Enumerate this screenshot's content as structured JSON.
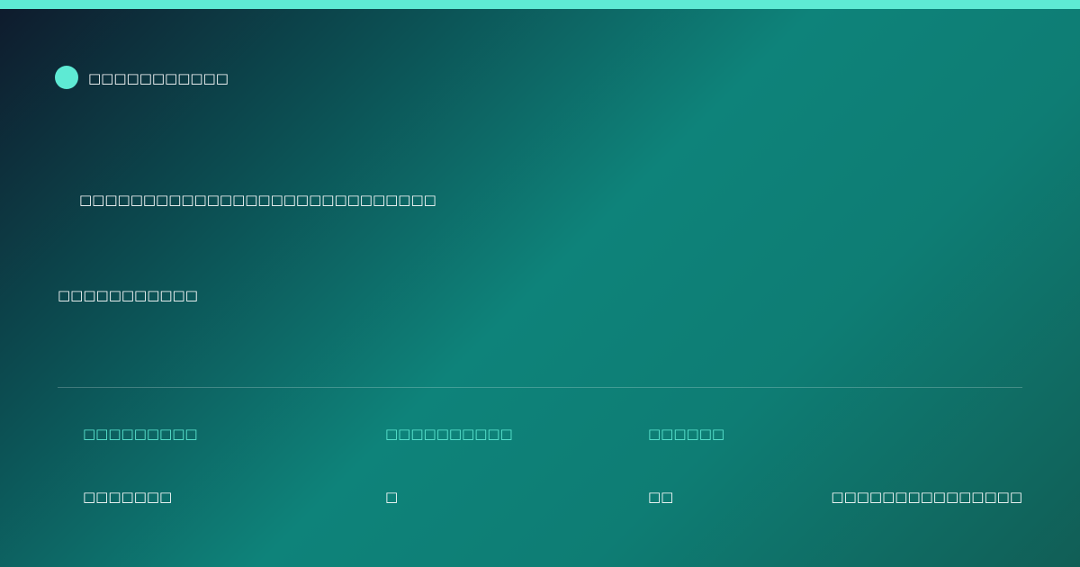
{
  "theme": {
    "accent": "#5eead4",
    "text": "#ffffff",
    "gradient": [
      "#0e1a2c",
      "#0c4e52",
      "#0e837a",
      "#115e56"
    ]
  },
  "brand": {
    "icon": "circle-logo-icon",
    "label": "□□□□□□□□□□□"
  },
  "headline": "□□□□□□□□□□□□□□□□□□□□□□□□□□□□",
  "subtext": "□□□□□□□□□□□",
  "stats": [
    {
      "label": "□□□□□□□□□",
      "value": "□□□□□□□"
    },
    {
      "label": "□□□□□□□□□□",
      "value": "□"
    },
    {
      "label": "□□□□□□",
      "value": "□□"
    }
  ],
  "footer_note": "□□□□□□□□□□□□□□□"
}
